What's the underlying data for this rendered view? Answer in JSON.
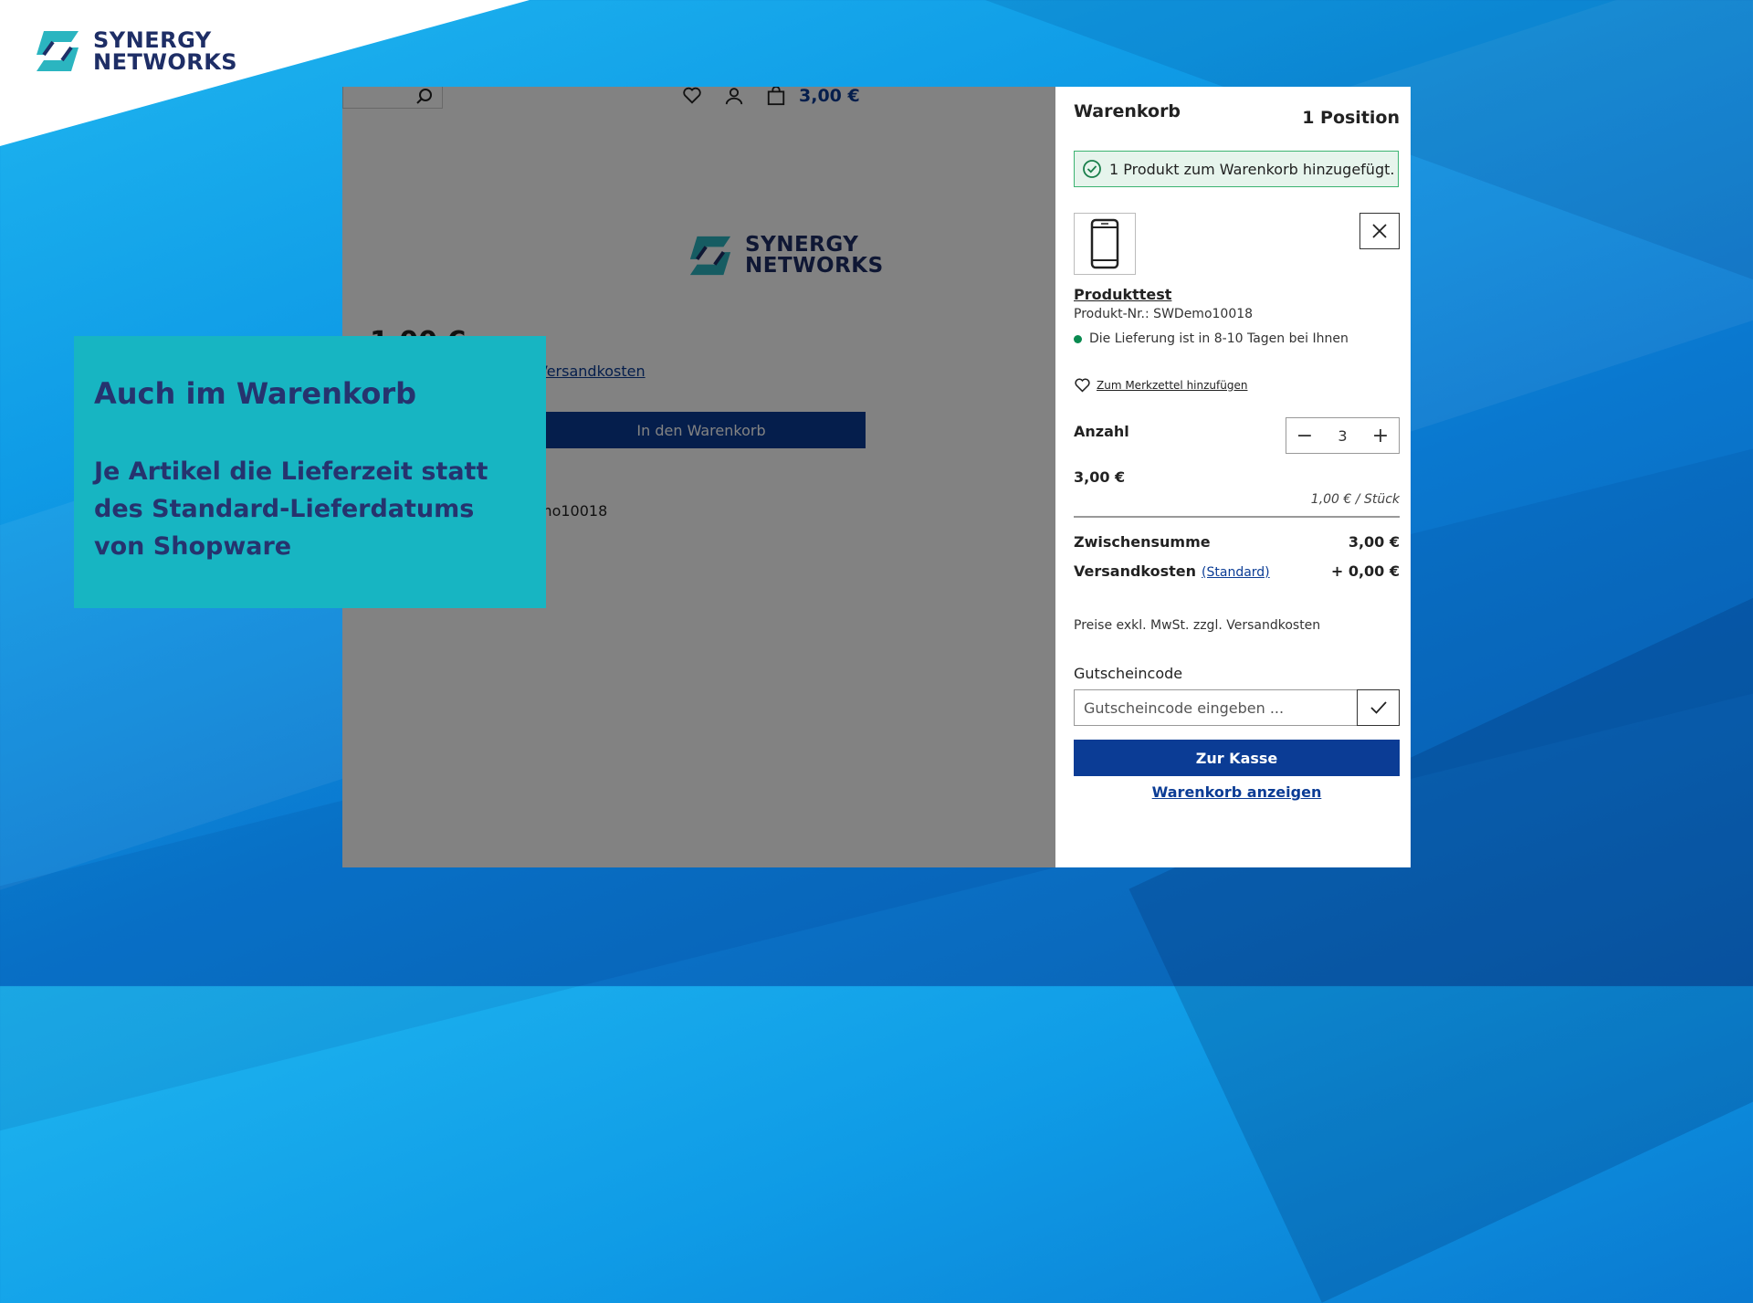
{
  "brand": {
    "line1": "SYNERGY",
    "line2": "NETWORKS"
  },
  "shop": {
    "cart_total": "3,00 €",
    "price_partial": "1,00 €",
    "shipping_link_partial": "Versandkosten",
    "add_to_cart_label": "In den Warenkorb",
    "product_number_partial": "mo10018"
  },
  "callout": {
    "heading": "Auch im Warenkorb",
    "text": "Je Artikel die Lieferzeit statt des Standard-Lieferdatums von Shopware"
  },
  "cart": {
    "title": "Warenkorb",
    "positions": "1 Position",
    "alert": "1 Produkt zum Warenkorb hinzugefügt.",
    "product_name": "Produkttest",
    "product_number": "Produkt-Nr.: SWDemo10018",
    "delivery": "Die Lieferung ist in 8-10 Tagen bei Ihnen",
    "wishlist": "Zum Merkzettel hinzufügen",
    "quantity_label": "Anzahl",
    "quantity": "3",
    "line_price": "3,00 €",
    "unit_price": "1,00 € / Stück",
    "subtotal_label": "Zwischensumme",
    "subtotal_value": "3,00 €",
    "shipping_label": "Versandkosten",
    "shipping_method": "(Standard)",
    "shipping_value": "+ 0,00 €",
    "vat_note": "Preise exkl. MwSt. zzgl. Versandkosten",
    "voucher_label": "Gutscheincode",
    "voucher_placeholder": "Gutscheincode eingeben ...",
    "checkout_label": "Zur Kasse",
    "show_cart_label": "Warenkorb anzeigen"
  },
  "colors": {
    "primary": "#0b3c95",
    "callout_bg": "#17b5c2",
    "callout_text": "#26336e",
    "success": "#3cb371",
    "delivery_dot": "#0a8a50"
  }
}
